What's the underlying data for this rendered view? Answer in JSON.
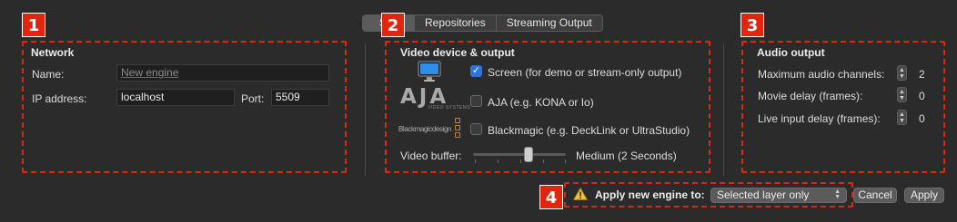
{
  "tabs": [
    {
      "label": "S",
      "suffix": "ss",
      "active": true
    },
    {
      "label": "Repositories",
      "active": false
    },
    {
      "label": "Streaming Output",
      "active": false
    }
  ],
  "badges": [
    "1",
    "2",
    "3",
    "4"
  ],
  "network": {
    "heading": "Network",
    "name_label": "Name:",
    "name_placeholder": "New engine",
    "ip_label": "IP address:",
    "ip_value": "localhost",
    "port_label": "Port:",
    "port_value": "5509"
  },
  "video": {
    "heading": "Video device & output",
    "options": [
      {
        "icon": "monitor-icon",
        "label": "Screen (for demo or stream-only output)",
        "checked": true
      },
      {
        "icon": "aja-logo",
        "logo_text": "AJA",
        "logo_sub": "VIDEO SYSTEMS",
        "label": "AJA (e.g. KONA or Io)",
        "checked": false
      },
      {
        "icon": "blackmagic-logo",
        "logo_text": "Blackmagicdesign",
        "label": "Blackmagic (e.g. DeckLink or UltraStudio)",
        "checked": false
      }
    ],
    "buffer_label": "Video buffer:",
    "buffer_value_text": "Medium (2 Seconds)",
    "buffer_level": 0.6
  },
  "audio": {
    "heading": "Audio output",
    "rows": [
      {
        "label": "Maximum audio channels:",
        "value": "2"
      },
      {
        "label": "Movie delay (frames):",
        "value": "0"
      },
      {
        "label": "Live input delay (frames):",
        "value": "0"
      }
    ]
  },
  "footer": {
    "warning_icon": "warning-icon",
    "apply_label": "Apply new engine to:",
    "target_value": "Selected layer only",
    "cancel_label": "Cancel",
    "apply_button": "Apply"
  },
  "colors": {
    "background": "#2b2b2b",
    "accent": "#2f74d8",
    "annotation": "#e0260f"
  }
}
